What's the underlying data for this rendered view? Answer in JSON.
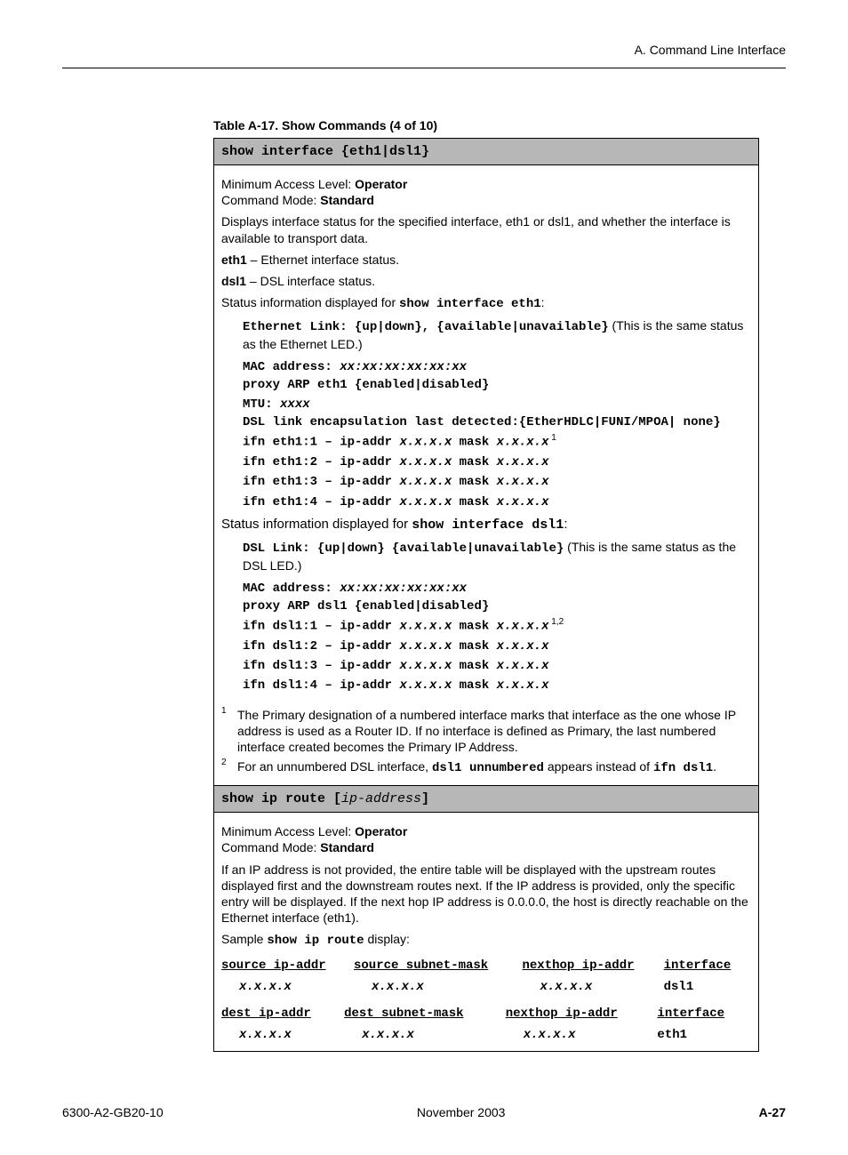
{
  "header": {
    "section": "A. Command Line Interface"
  },
  "caption": "Table A-17.  Show Commands (4 of 10)",
  "cmd1": {
    "title": "show interface {eth1|dsl1}",
    "min_access_label": "Minimum Access Level: ",
    "min_access_value": "Operator",
    "cmd_mode_label": "Command Mode: ",
    "cmd_mode_value": "Standard",
    "desc": "Displays interface status for the specified interface, eth1 or dsl1, and whether the interface is available to transport data.",
    "eth1_label": "eth1",
    "eth1_desc": " – Ethernet interface status.",
    "dsl1_label": "dsl1",
    "dsl1_desc": " – DSL interface status.",
    "status_eth1_pre": "Status information displayed for ",
    "status_eth1_cmd": "show interface eth1",
    "status_eth1_post": ":",
    "eth_block": {
      "l1a": "Ethernet Link: {up|down}, {available|unavailable}",
      "l1b": " (This is the same status as the Ethernet LED.)",
      "l2": "MAC address: ",
      "l2v": "xx:xx:xx:xx:xx:xx",
      "l3": "proxy ARP eth1 {enabled|disabled}",
      "l4": "MTU: ",
      "l4v": "xxxx",
      "l5": "DSL link encapsulation last detected:{EtherHDLC|FUNI/MPOA| none}",
      "l6a": "ifn eth1:1 – ip-addr ",
      "l6b": "x.x.x.x",
      "l6c": "  mask ",
      "l6d": "x.x.x.x",
      "l6sup": " 1",
      "l7a": "ifn eth1:2 – ip-addr ",
      "l7b": "x.x.x.x",
      "l7c": "  mask ",
      "l7d": "x.x.x.x",
      "l8a": "ifn eth1:3 – ip-addr ",
      "l8b": "x.x.x.x",
      "l8c": "  mask ",
      "l8d": "x.x.x.x",
      "l9a": "ifn eth1:4 – ip-addr ",
      "l9b": "x.x.x.x",
      "l9c": "  mask ",
      "l9d": "x.x.x.x"
    },
    "status_dsl1_pre": "Status information displayed for ",
    "status_dsl1_cmd": "show interface dsl1",
    "status_dsl1_post": ":",
    "dsl_block": {
      "l1a": "DSL Link: {up|down}  {available|unavailable}",
      "l1b": " (This is the same status as the DSL LED.)",
      "l2": "MAC address: ",
      "l2v": "xx:xx:xx:xx:xx:xx",
      "l3": "proxy ARP dsl1 {enabled|disabled}",
      "l6a": "ifn dsl1:1 – ip-addr ",
      "l6b": "x.x.x.x",
      "l6c": "  mask ",
      "l6d": "x.x.x.x",
      "l6sup": " 1,2",
      "l7a": "ifn dsl1:2 – ip-addr ",
      "l7b": "x.x.x.x",
      "l7c": "  mask ",
      "l7d": "x.x.x.x",
      "l8a": "ifn dsl1:3 – ip-addr ",
      "l8b": "x.x.x.x",
      "l8c": "  mask ",
      "l8d": "x.x.x.x",
      "l9a": "ifn dsl1:4 – ip-addr ",
      "l9b": "x.x.x.x",
      "l9c": "  mask ",
      "l9d": "x.x.x.x"
    },
    "fn1_num": "1",
    "fn1": "The Primary designation of a numbered interface marks that interface as the one whose IP address is used as a Router ID. If no interface is defined as Primary, the last numbered interface created becomes the Primary IP Address.",
    "fn2_num": "2",
    "fn2a": "For an unnumbered DSL interface, ",
    "fn2b": "dsl1 unnumbered",
    "fn2c": " appears instead of ",
    "fn2d": "ifn dsl1",
    "fn2e": "."
  },
  "cmd2": {
    "title_a": "show ip route [",
    "title_b": "ip-address",
    "title_c": "]",
    "min_access_label": "Minimum Access Level: ",
    "min_access_value": "Operator",
    "cmd_mode_label": "Command Mode: ",
    "cmd_mode_value": "Standard",
    "desc": "If an IP address is not provided, the entire table will be displayed with the upstream routes displayed first and the downstream routes next. If the IP address is provided, only the specific entry will be displayed. If the next hop IP address is 0.0.0.0, the host is directly reachable on the Ethernet interface (eth1).",
    "sample_pre": "Sample ",
    "sample_cmd": "show ip route",
    "sample_post": " display:",
    "route1": {
      "h1": "source ip-addr",
      "h2": "source subnet-mask",
      "h3": "nexthop ip-addr",
      "h4": "interface",
      "c1": "x.x.x.x",
      "c2": "x.x.x.x",
      "c3": "x.x.x.x",
      "c4": "dsl1"
    },
    "route2": {
      "h1": "dest ip-addr",
      "h2": "dest subnet-mask",
      "h3": "nexthop ip-addr",
      "h4": "interface",
      "c1": "x.x.x.x",
      "c2": "x.x.x.x",
      "c3": "x.x.x.x",
      "c4": "eth1"
    }
  },
  "footer": {
    "left": "6300-A2-GB20-10",
    "center": "November 2003",
    "right": "A-27"
  }
}
